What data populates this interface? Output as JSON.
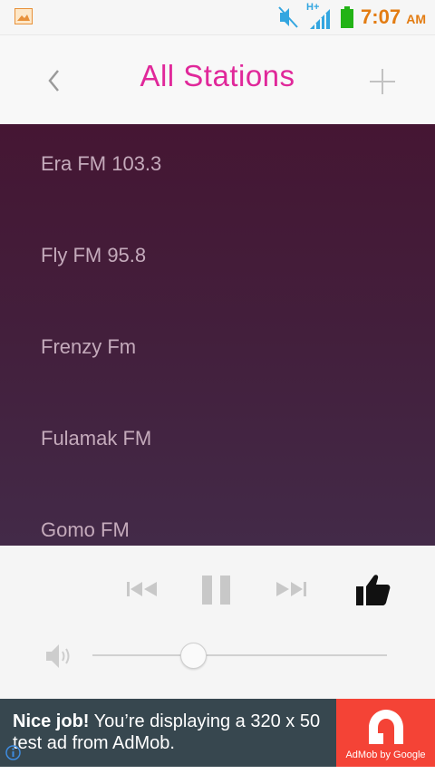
{
  "status_bar": {
    "time": "7:07",
    "ampm": "AM",
    "network": "H+",
    "accent_color": "#e37c12"
  },
  "header": {
    "title": "All Stations",
    "title_color": "#e0289a"
  },
  "stations": [
    {
      "name": "Era FM 103.3"
    },
    {
      "name": "Fly FM 95.8"
    },
    {
      "name": "Frenzy Fm"
    },
    {
      "name": "Fulamak FM"
    },
    {
      "name": "Gomo FM"
    }
  ],
  "player": {
    "volume_level": 0.34,
    "state": "paused-control-shown"
  },
  "ad": {
    "headline": "Nice job!",
    "body": " You’re displaying a 320 x 50 test ad from AdMob.",
    "brand": "AdMob by Google"
  }
}
